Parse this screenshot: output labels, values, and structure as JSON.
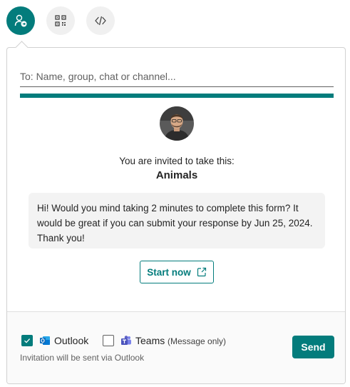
{
  "share_options": [
    {
      "icon": "person-send-icon",
      "active": true
    },
    {
      "icon": "qr-code-icon",
      "active": false
    },
    {
      "icon": "code-embed-icon",
      "active": false
    }
  ],
  "recipient": {
    "placeholder": "To: Name, group, chat or channel...",
    "value": ""
  },
  "invite": {
    "text": "You are invited to take this:",
    "form_title": "Animals",
    "message": "Hi! Would you mind taking 2 minutes to complete this form? It would be great if you can submit your response by Jun 25, 2024. Thank you!",
    "start_label": "Start now"
  },
  "footer": {
    "outlook": {
      "label": "Outlook",
      "checked": true
    },
    "teams": {
      "label": "Teams",
      "note": "(Message only)",
      "checked": false
    },
    "status": "Invitation will be sent via Outlook",
    "send_label": "Send"
  },
  "colors": {
    "accent": "#037c7c",
    "outlook_blue": "#0f6cbd",
    "teams_purple": "#5b5fc7"
  }
}
